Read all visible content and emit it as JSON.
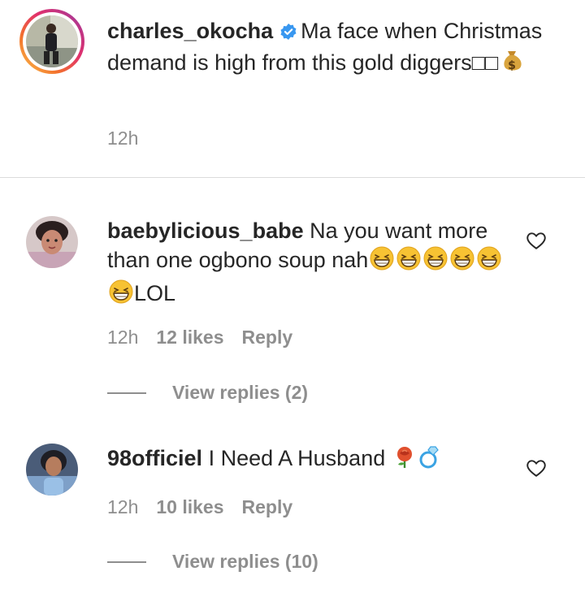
{
  "caption": {
    "username": "charles_okocha",
    "text": "Ma face when Christmas demand is high from this gold diggers",
    "trailing_glyphs": "□□",
    "emoji": "money-bag-emoji",
    "time": "12h",
    "verified": true
  },
  "comments": [
    {
      "username": "baebylicious_babe",
      "text": "Na you want more than one ogbono soup nah",
      "emoji_count": 6,
      "emoji": "grinning-squinting-face-emoji",
      "after_emoji_text": "LOL",
      "time": "12h",
      "likes": "12 likes",
      "reply_label": "Reply",
      "view_replies": "View replies (2)"
    },
    {
      "username": "98officiel",
      "text": "I Need A Husband",
      "emoji": [
        "rose-emoji",
        "ring-emoji"
      ],
      "time": "12h",
      "likes": "10 likes",
      "reply_label": "Reply",
      "view_replies": "View replies (10)"
    }
  ],
  "colors": {
    "text": "#262626",
    "secondary": "#8e8e8e",
    "verified": "#3897f0",
    "divider": "#dbdbdb"
  }
}
